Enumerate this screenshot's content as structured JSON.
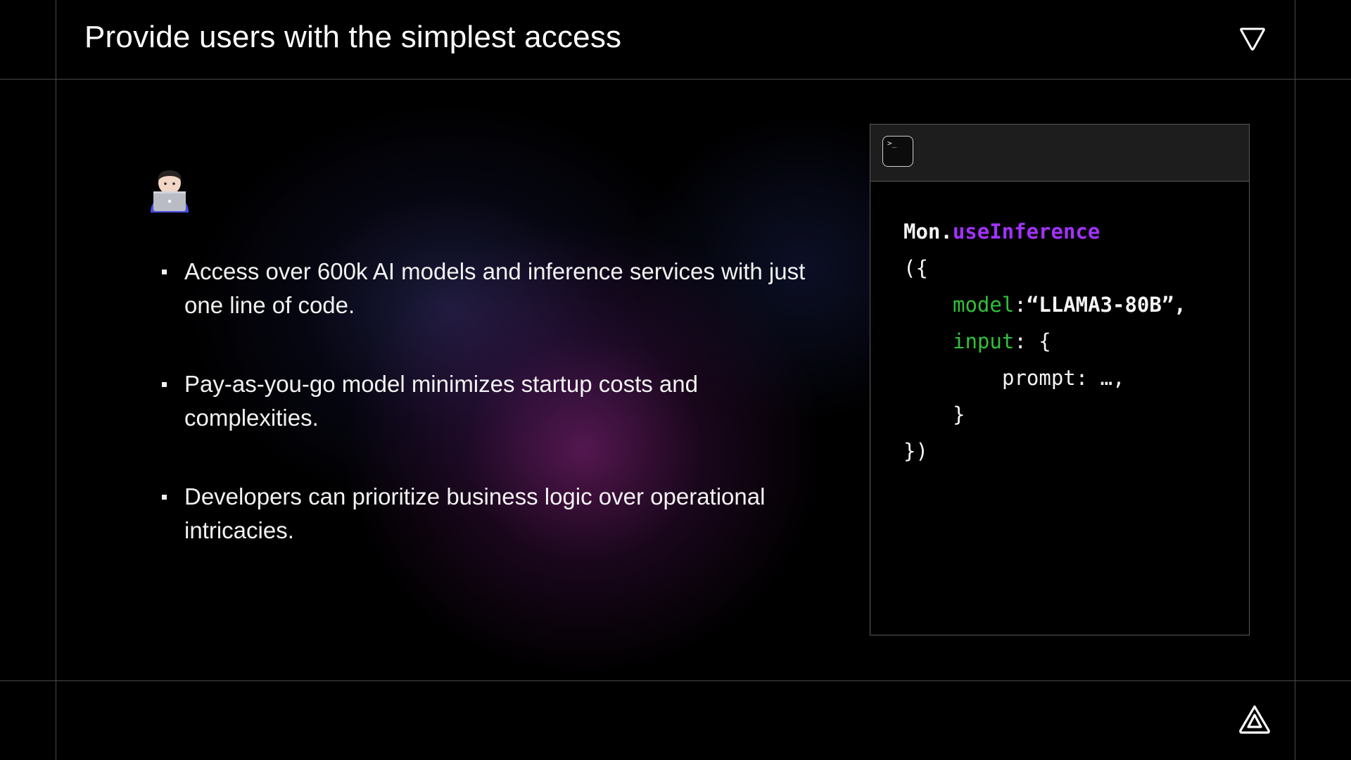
{
  "slide": {
    "title": "Provide users with the simplest access"
  },
  "icons": {
    "top_right": "triangle-down-logo-icon",
    "bottom_right": "triangle-up-logo-icon",
    "person": "technologist-emoji-icon",
    "terminal": "terminal-icon"
  },
  "bullets": [
    "Access over 600k AI models and inference services with just one line of code.",
    "Pay-as-you-go model minimizes startup costs and complexities.",
    "Developers can prioritize business logic over operational intricacies."
  ],
  "code": {
    "terminal_glyph": ">_",
    "object": "Mon.",
    "method": "useInference",
    "open": "({",
    "model_key": "model",
    "model_sep": ":",
    "model_value": "“LLAMA3-80B”,",
    "input_key": "input",
    "input_rest": ": {",
    "prompt_line": "prompt: …,",
    "close_inner": "}",
    "close": "})"
  },
  "colors": {
    "background": "#000000",
    "accent_purple": "#a232ff",
    "accent_green": "#30c13a",
    "grid_line": "#4a4a4a"
  }
}
